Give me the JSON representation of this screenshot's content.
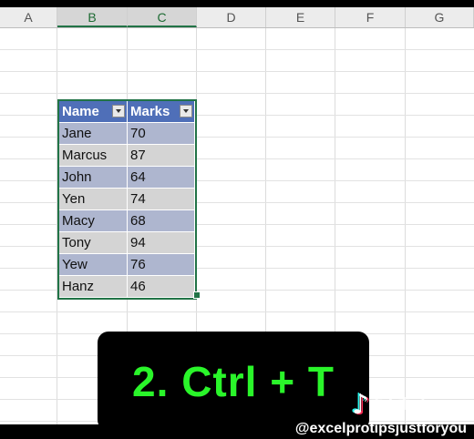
{
  "columns": [
    {
      "label": "A",
      "selected": false
    },
    {
      "label": "B",
      "selected": true
    },
    {
      "label": "C",
      "selected": true
    },
    {
      "label": "D",
      "selected": false
    },
    {
      "label": "E",
      "selected": false
    },
    {
      "label": "F",
      "selected": false
    },
    {
      "label": "G",
      "selected": false
    }
  ],
  "table": {
    "headers": [
      "Name",
      "Marks"
    ],
    "rows": [
      [
        "Jane",
        "70"
      ],
      [
        "Marcus",
        "87"
      ],
      [
        "John",
        "64"
      ],
      [
        "Yen",
        "74"
      ],
      [
        "Macy",
        "68"
      ],
      [
        "Tony",
        "94"
      ],
      [
        "Yew",
        "76"
      ],
      [
        "Hanz",
        "46"
      ]
    ]
  },
  "overlay": {
    "caption": "2. Ctrl + T",
    "logo_text": "TikTok",
    "logo_icon": "tiktok-note-icon",
    "handle": "@excelprotipsjustforyou"
  },
  "colors": {
    "table_header": "#4f6fb8",
    "band_a": "#aeb6cf",
    "band_b": "#d4d4d4",
    "selection": "#217346",
    "caption_text": "#2af52a"
  }
}
